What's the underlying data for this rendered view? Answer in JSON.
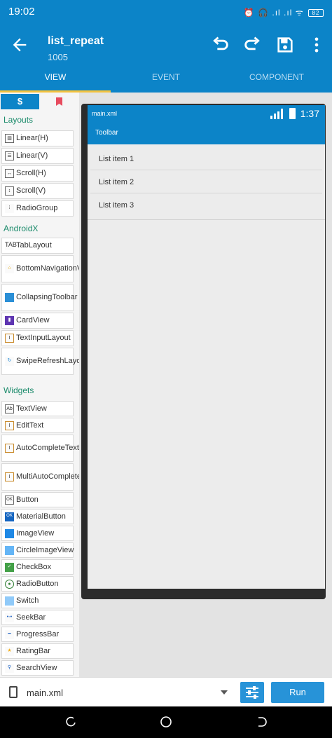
{
  "status_bar": {
    "time": "19:02",
    "icons": "⏰ 🎧 .ıl .ıl ᯤ",
    "battery": "82"
  },
  "app_bar": {
    "title": "list_repeat",
    "subtitle": "1005"
  },
  "toolbar_icons": [
    "undo-icon",
    "redo-icon",
    "save-icon",
    "more-vert-icon"
  ],
  "tabs": [
    {
      "label": "VIEW",
      "active": true
    },
    {
      "label": "EVENT",
      "active": false
    },
    {
      "label": "COMPONENT",
      "active": false
    }
  ],
  "palette": {
    "tab_s_label": "$",
    "sections": {
      "layouts": "Layouts",
      "androidx": "AndroidX",
      "widgets": "Widgets"
    },
    "layouts": [
      "Linear(H)",
      "Linear(V)",
      "Scroll(H)",
      "Scroll(V)",
      "RadioGroup"
    ],
    "androidx": [
      "TabLayout",
      "BottomNavigationView",
      "CollapsingToolbar",
      "CardView",
      "TextInputLayout",
      "SwipeRefreshLayout"
    ],
    "widgets": [
      "TextView",
      "EditText",
      "AutoCompleteTextView",
      "MultiAutoCompleteTextView",
      "Button",
      "MaterialButton",
      "ImageView",
      "CircleImageView",
      "CheckBox",
      "RadioButton",
      "Switch",
      "SeekBar",
      "ProgressBar",
      "RatingBar",
      "SearchView"
    ]
  },
  "preview": {
    "file_label": "main.xml",
    "time": "1:37",
    "toolbar_title": "Toolbar",
    "list_items": [
      "List item 1",
      "List item 2",
      "List item 3"
    ]
  },
  "bottom_bar": {
    "file": "main.xml",
    "run_label": "Run"
  },
  "colors": {
    "primary": "#0c84c8",
    "accent": "#f3c23e",
    "section": "#1a8a6a",
    "button": "#2793d8"
  }
}
